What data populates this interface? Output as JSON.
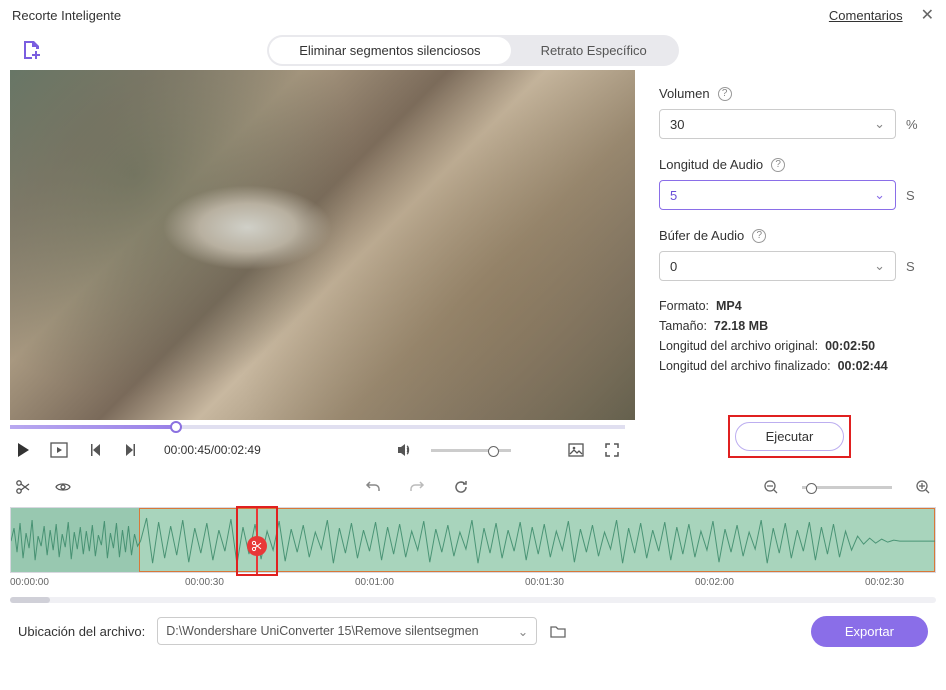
{
  "window": {
    "title": "Recorte Inteligente",
    "comments": "Comentarios"
  },
  "tabs": {
    "silent": "Eliminar segmentos silenciosos",
    "portrait": "Retrato Específico"
  },
  "playback": {
    "current": "00:00:45",
    "total": "00:02:49"
  },
  "sidebar": {
    "volume_label": "Volumen",
    "volume_value": "30",
    "volume_unit": "%",
    "audiolen_label": "Longitud de Audio",
    "audiolen_value": "5",
    "audiolen_unit": "S",
    "buffer_label": "Búfer de Audio",
    "buffer_value": "0",
    "buffer_unit": "S",
    "format_label": "Formato:",
    "format_value": "MP4",
    "size_label": "Tamaño:",
    "size_value": "72.18 MB",
    "orig_label": "Longitud del archivo original:",
    "orig_value": "00:02:50",
    "final_label": "Longitud del archivo finalizado:",
    "final_value": "00:02:44",
    "run": "Ejecutar"
  },
  "timeline": {
    "ticks": [
      "00:00:00",
      "00:00:30",
      "00:01:00",
      "00:01:30",
      "00:02:00",
      "00:02:30"
    ]
  },
  "footer": {
    "location_label": "Ubicación del archivo:",
    "path": "D:\\Wondershare UniConverter 15\\Remove silentsegmen",
    "export": "Exportar"
  }
}
